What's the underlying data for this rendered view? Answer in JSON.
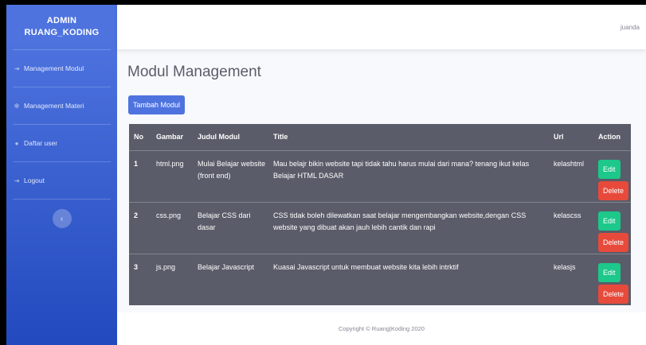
{
  "sidebar": {
    "brand_line1": "ADMIN",
    "brand_line2": "RUANG_KODING",
    "items": [
      {
        "label": "Management Modul",
        "icon": "sign-in-icon"
      },
      {
        "label": "Management Materi",
        "icon": "gear-icon"
      },
      {
        "label": "Daftar user",
        "icon": "user-icon"
      },
      {
        "label": "Logout",
        "icon": "sign-out-icon"
      }
    ],
    "toggle_icon": "chevron-left-icon"
  },
  "topbar": {
    "user_name": "juanda"
  },
  "main": {
    "title": "Modul Management",
    "add_button": "Tambah Modul",
    "table": {
      "headers": [
        "No",
        "Gambar",
        "Judul Modul",
        "Title",
        "Url",
        "Action"
      ],
      "rows": [
        {
          "no": "1",
          "gambar": "html.png",
          "judul": "Mulai Belajar website (front end)",
          "title": "Mau belajr bikin website tapi tidak tahu harus mulai dari mana? tenang ikut kelas Belajar HTML DASAR",
          "url": "kelashtml"
        },
        {
          "no": "2",
          "gambar": "css.png",
          "judul": "Belajar CSS dari dasar",
          "title": "CSS tidak boleh dilewatkan saat belajar mengembangkan website,dengan CSS website yang dibuat akan jauh lebih cantik dan rapi",
          "url": "kelascss"
        },
        {
          "no": "3",
          "gambar": "js.png",
          "judul": "Belajar Javascript",
          "title": "Kuasai Javascript untuk membuat website kita lebih intrktif",
          "url": "kelasjs"
        }
      ],
      "edit_label": "Edit",
      "delete_label": "Delete"
    }
  },
  "footer": {
    "text": "Copyright © Ruang|Koding 2020"
  },
  "colors": {
    "primary": "#4e73df",
    "success": "#1cc88a",
    "danger": "#e74a3b",
    "table_bg": "#5a5c69"
  }
}
